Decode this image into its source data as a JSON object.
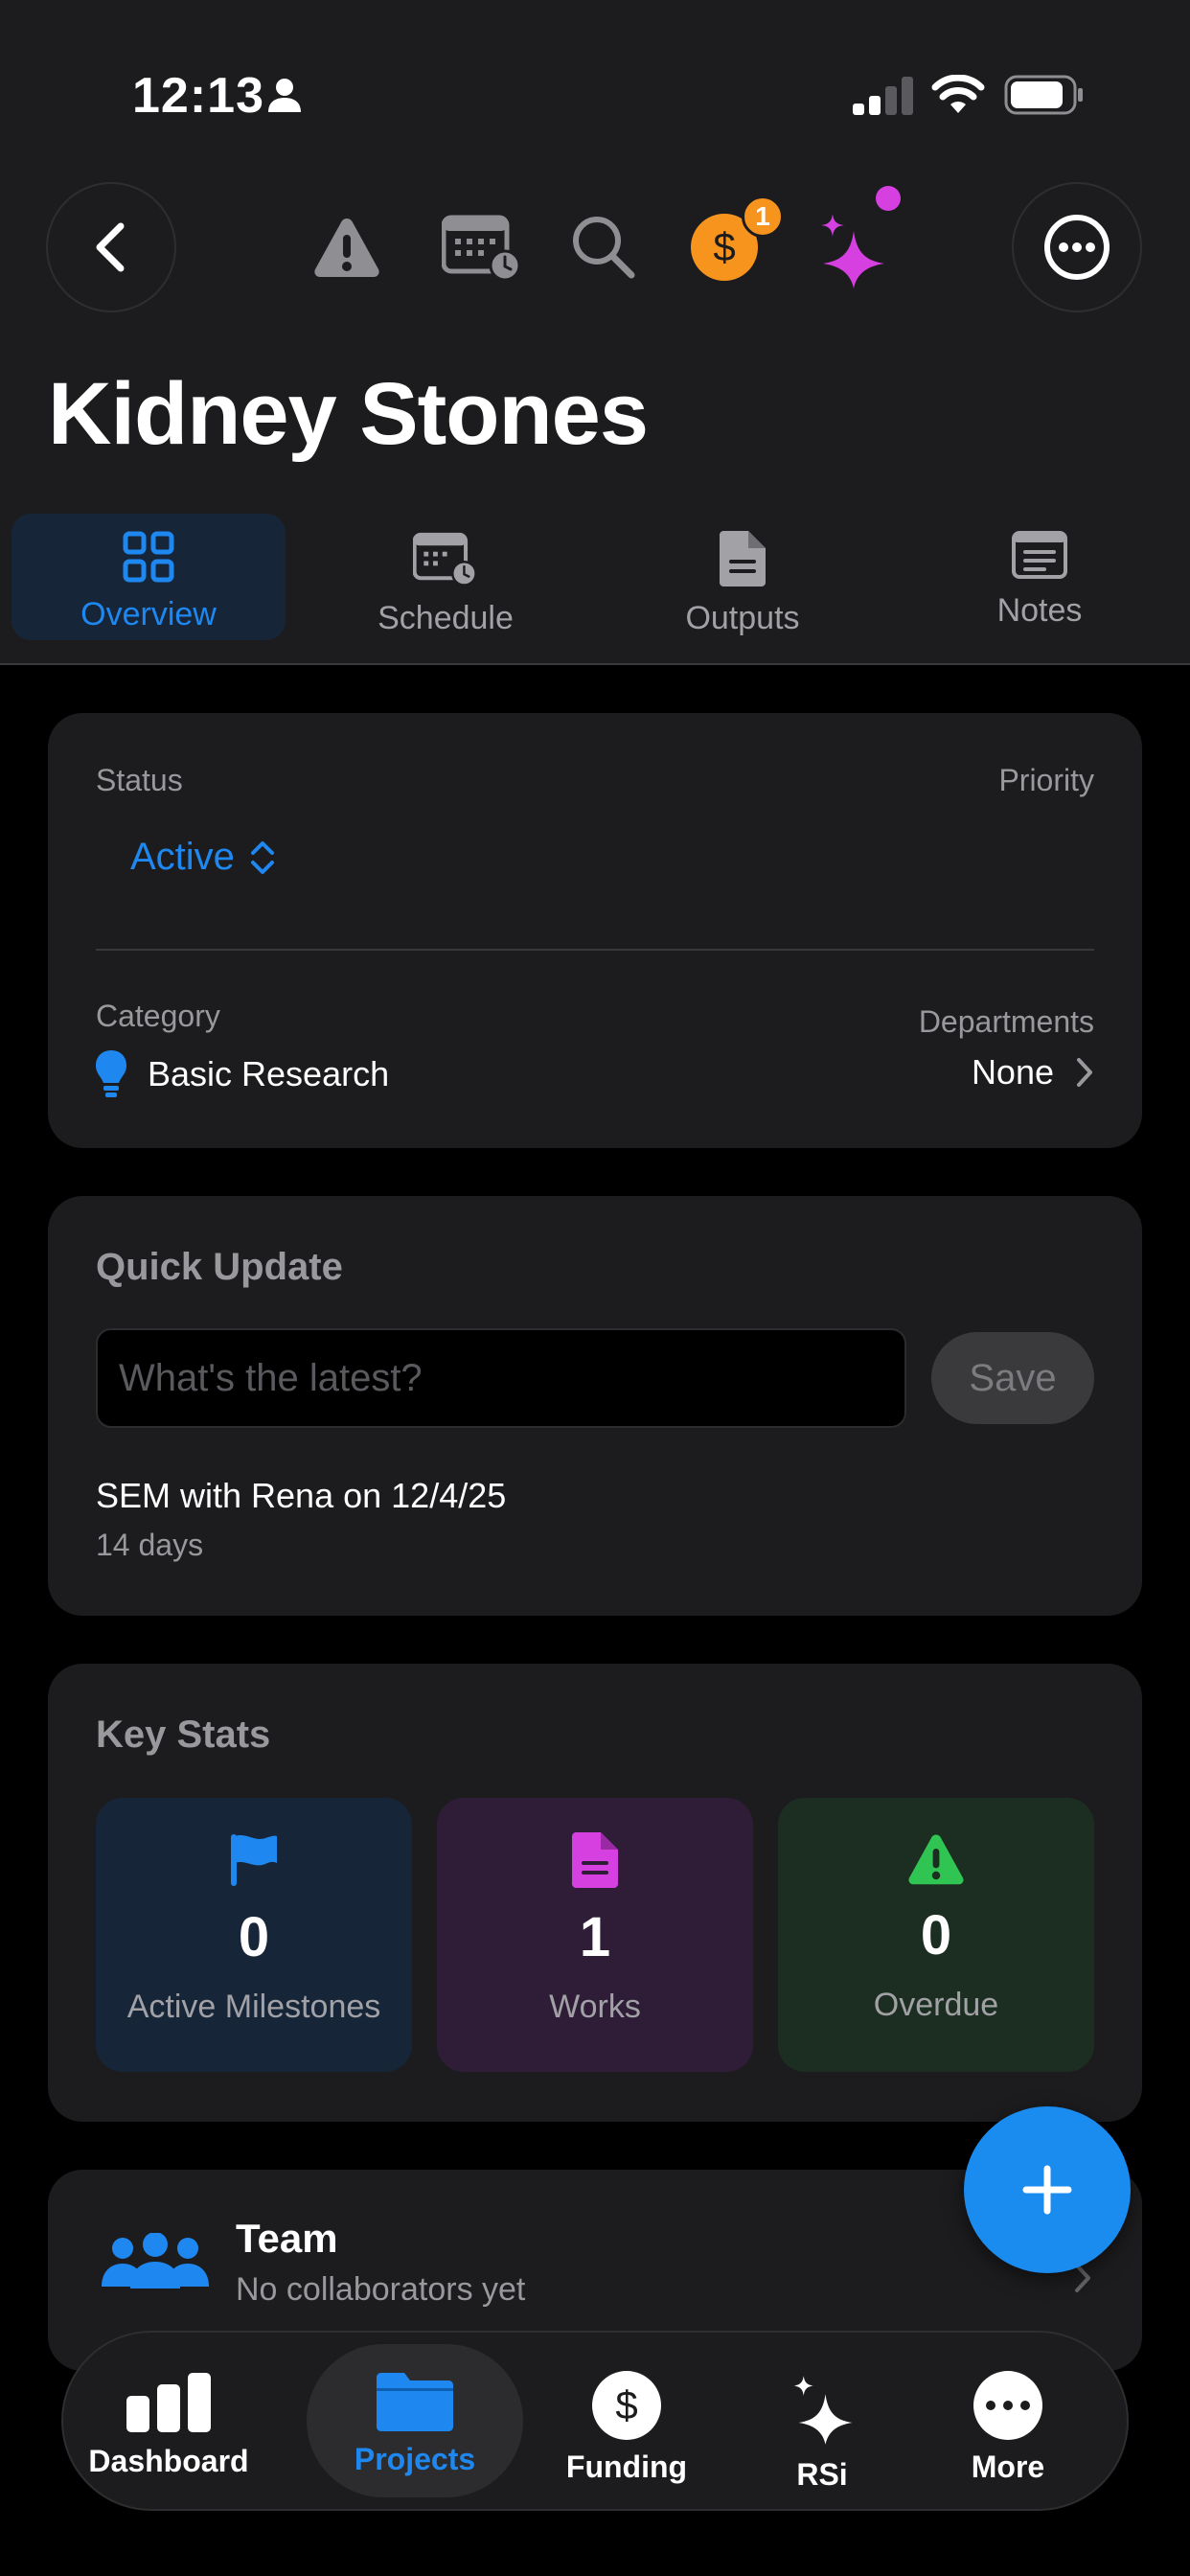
{
  "status_bar": {
    "time": "12:13"
  },
  "header": {
    "title": "Kidney Stones",
    "toolbar_icons": [
      "warning-icon",
      "calendar-clock-icon",
      "search-icon",
      "funding-dollar-icon",
      "sparkles-icon"
    ],
    "funding_badge": "1"
  },
  "tabs": [
    {
      "label": "Overview",
      "icon": "grid-icon",
      "active": true
    },
    {
      "label": "Schedule",
      "icon": "calendar-clock-icon",
      "active": false
    },
    {
      "label": "Outputs",
      "icon": "document-icon",
      "active": false
    },
    {
      "label": "Notes",
      "icon": "notes-icon",
      "active": false
    }
  ],
  "details": {
    "status_label": "Status",
    "status_value": "Active",
    "priority_label": "Priority",
    "category_label": "Category",
    "category_value": "Basic Research",
    "departments_label": "Departments",
    "departments_value": "None"
  },
  "quick_update": {
    "title": "Quick Update",
    "placeholder": "What's the latest?",
    "save_label": "Save",
    "last_update_text": "SEM with Rena on 12/4/25",
    "last_update_age": "14 days"
  },
  "key_stats": {
    "title": "Key Stats",
    "items": [
      {
        "value": "0",
        "label": "Active Milestones",
        "icon": "flag-icon",
        "color": "#1e88f0"
      },
      {
        "value": "1",
        "label": "Works",
        "icon": "document-icon",
        "color": "#d63fe0"
      },
      {
        "value": "0",
        "label": "Overdue",
        "icon": "warning-icon",
        "color": "#30c452"
      }
    ]
  },
  "team": {
    "title": "Team",
    "subtitle": "No collaborators yet"
  },
  "tab_bar": {
    "items": [
      {
        "label": "Dashboard",
        "icon": "bar-chart-icon",
        "active": false
      },
      {
        "label": "Projects",
        "icon": "folder-icon",
        "active": true
      },
      {
        "label": "Funding",
        "icon": "dollar-icon",
        "active": false
      },
      {
        "label": "RSi",
        "icon": "sparkles-icon",
        "active": false
      },
      {
        "label": "More",
        "icon": "ellipsis-icon",
        "active": false
      }
    ]
  },
  "colors": {
    "accent": "#1e88f0",
    "background": "#000000",
    "card": "#1c1c1e",
    "funding_orange": "#f7941d",
    "sparkle_magenta": "#d63fe0"
  }
}
